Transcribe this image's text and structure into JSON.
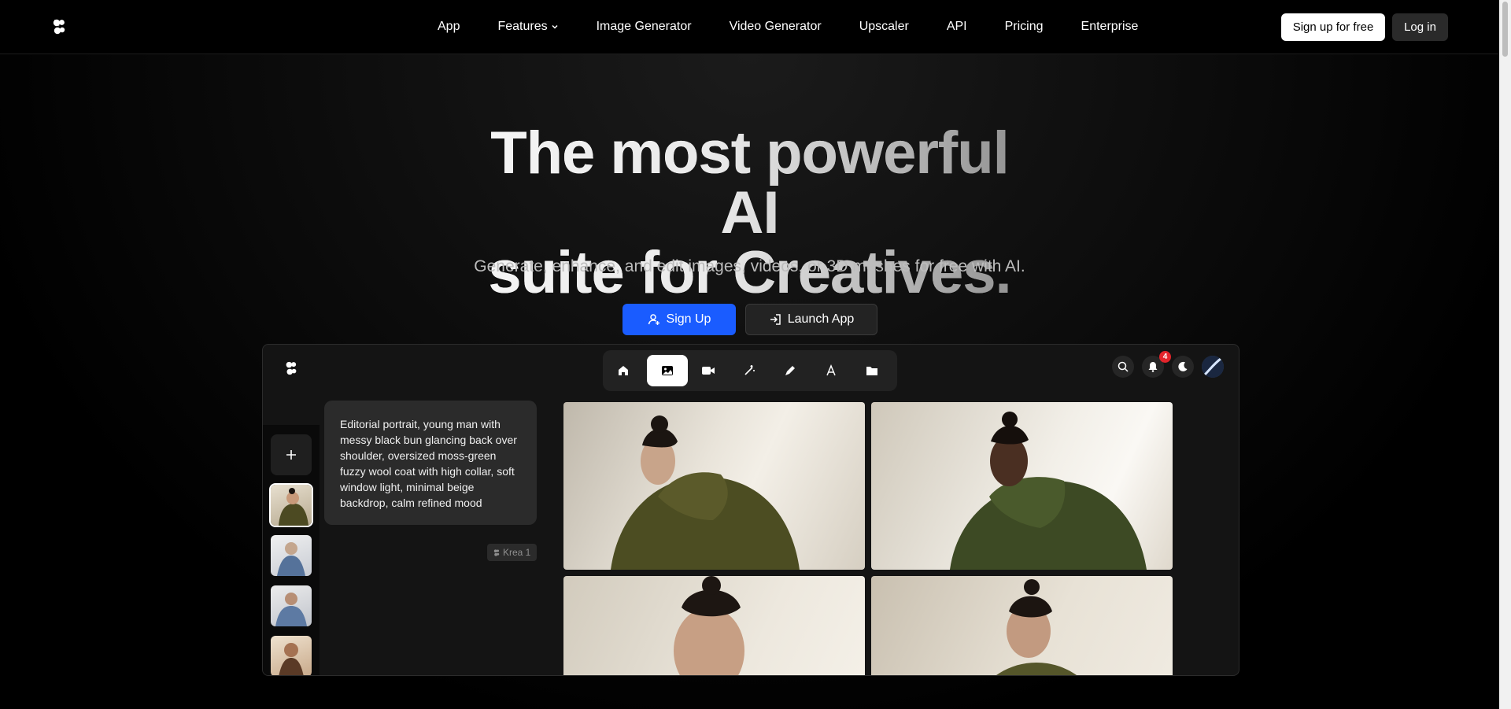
{
  "nav": {
    "links": [
      "App",
      "Features",
      "Image Generator",
      "Video Generator",
      "Upscaler",
      "API",
      "Pricing",
      "Enterprise"
    ],
    "signup_label": "Sign up for free",
    "login_label": "Log in"
  },
  "hero": {
    "headline_line1": "The most powerful AI",
    "headline_line2": "suite for Creatives.",
    "subtitle": "Generate, enhance, and edit images, videos, or 3D meshes for free with AI.",
    "signup_label": "Sign Up",
    "launch_label": "Launch App",
    "accent_color": "#1a5cff"
  },
  "app_preview": {
    "toolbar_icons": [
      "home-icon",
      "image-icon",
      "video-icon",
      "enhance-icon",
      "edit-icon",
      "font-icon",
      "folder-icon"
    ],
    "notification_count": "4",
    "prompt": "Editorial portrait, young man with messy black bun glancing back over shoulder, oversized moss-green fuzzy wool coat with high collar, soft window light, minimal beige backdrop, calm refined mood",
    "model_tag": "Krea 1"
  }
}
